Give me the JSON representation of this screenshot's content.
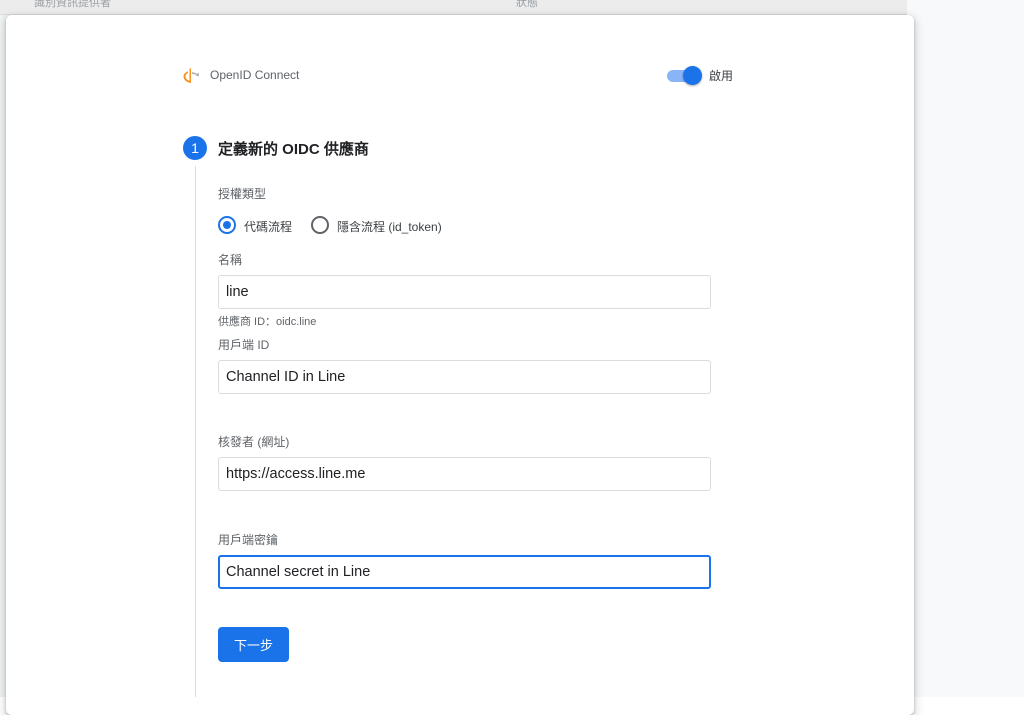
{
  "background_table": {
    "col1": "識別資訊提供者",
    "col2": "狀態"
  },
  "provider": {
    "name": "OpenID Connect",
    "enable_label": "啟用",
    "enabled": true
  },
  "step": {
    "number": "1",
    "title": "定義新的 OIDC 供應商"
  },
  "grant_type": {
    "label": "授權類型",
    "options": [
      {
        "label": "代碼流程",
        "selected": true
      },
      {
        "label": "隱含流程 (id_token)",
        "selected": false
      }
    ]
  },
  "name_field": {
    "label": "名稱",
    "value": "line",
    "hint": "供應商 ID：oidc.line"
  },
  "client_id_field": {
    "label": "用戶端 ID",
    "value": "Channel ID in Line"
  },
  "issuer_field": {
    "label": "核發者 (網址)",
    "value": "https://access.line.me"
  },
  "client_secret_field": {
    "label": "用戶端密鑰",
    "value": "Channel secret in Line"
  },
  "next_button": "下一步",
  "colors": {
    "accent": "#1a73e8",
    "toggle_track": "#8ab4f8",
    "logo_orange": "#f7931e",
    "logo_gray": "#b3b3b3"
  }
}
